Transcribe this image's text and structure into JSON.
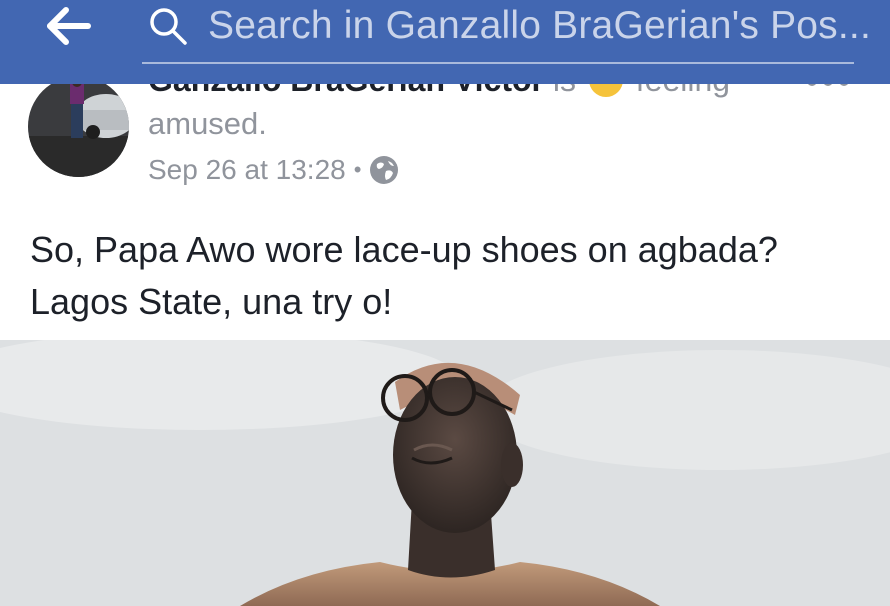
{
  "header": {
    "search_placeholder": "Search in Ganzallo BraGerian's Pos..."
  },
  "post": {
    "author_name": "Ganzallo BraGerian Victor",
    "is_text": "is",
    "feeling_label": "feeling",
    "feeling_value": "amused.",
    "timestamp": "Sep 26 at 13:28",
    "privacy_separator": "•",
    "text_line1": "So, Papa Awo wore lace-up shoes on agbada?",
    "text_line2": "Lagos State, una try o!"
  },
  "colors": {
    "brand_bar": "#4267b2",
    "meta_gray": "#90949c",
    "text_dark": "#1d2129"
  },
  "icons": {
    "back": "back-arrow-icon",
    "search": "search-icon",
    "privacy": "globe-icon",
    "more": "more-options-icon",
    "feeling": "smiley-emoji-icon"
  }
}
